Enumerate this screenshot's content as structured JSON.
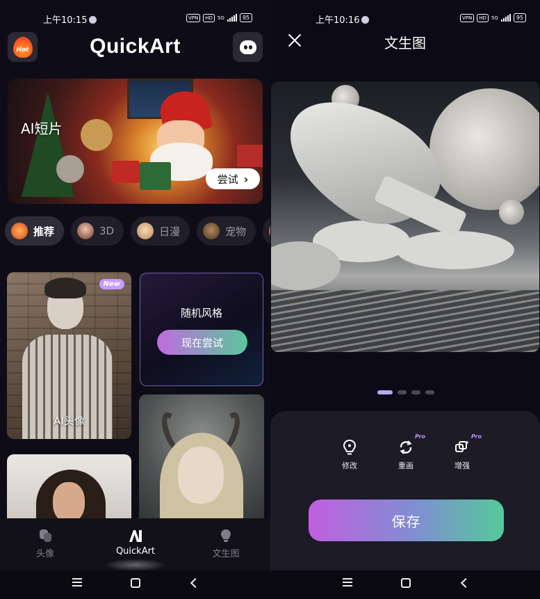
{
  "left_screen": {
    "status_bar": {
      "time": "上午10:15",
      "vpn": "VPN",
      "hd": "HD",
      "network": "5G",
      "battery": "95"
    },
    "header": {
      "app_title": "QuickArt",
      "hot_label": "Hot"
    },
    "banner": {
      "label": "AI短片",
      "try_label": "尝试",
      "try_chevron": "›"
    },
    "chips": [
      {
        "label": "推荐",
        "active": true
      },
      {
        "label": "3D",
        "active": false
      },
      {
        "label": "日漫",
        "active": false
      },
      {
        "label": "宠物",
        "active": false
      }
    ],
    "cards": {
      "ai_avatar": {
        "label": "AI头像",
        "badge": "New"
      },
      "random_style": {
        "title": "随机风格",
        "button": "现在尝试"
      }
    },
    "bottom_nav": [
      {
        "label": "头像",
        "active": false
      },
      {
        "label": "QuickArt",
        "active": true
      },
      {
        "label": "文生图",
        "active": false
      }
    ]
  },
  "right_screen": {
    "status_bar": {
      "time": "上午10:16",
      "vpn": "VPN",
      "hd": "HD",
      "network": "5G",
      "battery": "95"
    },
    "header": {
      "title": "文生图"
    },
    "carousel": {
      "page_count": 4,
      "active_index": 0
    },
    "tools": [
      {
        "label": "修改",
        "pro": false
      },
      {
        "label": "重画",
        "pro": true
      },
      {
        "label": "增强",
        "pro": true
      }
    ],
    "pro_badge": "Pro",
    "save_label": "保存"
  },
  "colors": {
    "background": "#0e0d17",
    "accent_gradient_start": "#c15fe0",
    "accent_gradient_end": "#55c99a",
    "active_dot": "#b8a9f0",
    "pro_badge": "#c58cff"
  },
  "icons": {
    "hot": "flame-icon",
    "robot": "robot-face-icon",
    "close": "close-icon",
    "edit": "lightbulb-pin-icon",
    "redraw": "refresh-icon",
    "enhance": "enhance-icon",
    "nav_avatar": "avatar-stack-icon",
    "nav_quickart": "ai-logo-icon",
    "nav_text2img": "lightbulb-icon"
  }
}
